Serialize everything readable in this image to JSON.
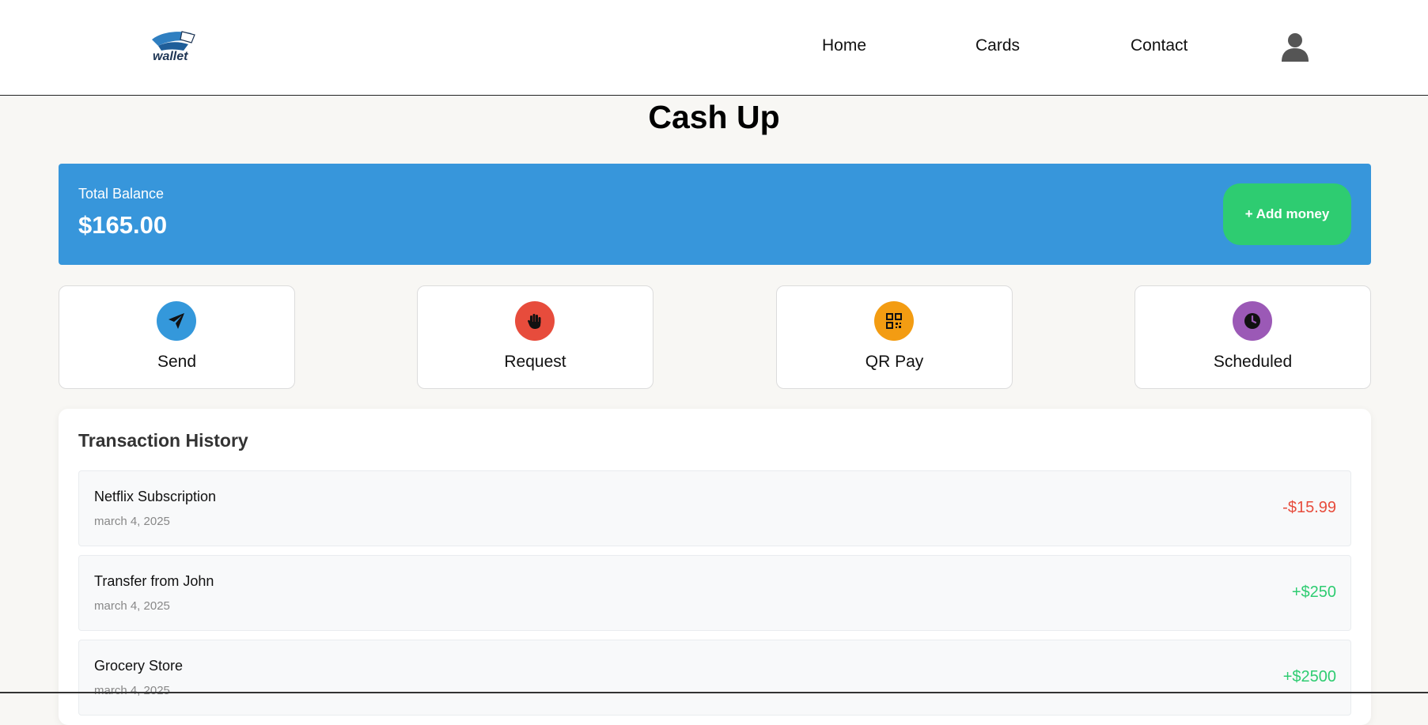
{
  "navbar": {
    "logo_text": "wallet",
    "links": [
      "Home",
      "Cards",
      "Contact"
    ]
  },
  "page": {
    "title": "Cash Up"
  },
  "balance": {
    "label": "Total Balance",
    "amount": "$165.00",
    "add_money_label": "+ Add money"
  },
  "actions": [
    {
      "label": "Send",
      "icon": "paper-plane-icon",
      "color": "#3498db"
    },
    {
      "label": "Request",
      "icon": "hand-icon",
      "color": "#e74c3c"
    },
    {
      "label": "QR Pay",
      "icon": "qr-code-icon",
      "color": "#f39c12"
    },
    {
      "label": "Scheduled",
      "icon": "clock-icon",
      "color": "#9b59b6"
    }
  ],
  "history": {
    "title": "Transaction History",
    "transactions": [
      {
        "name": "Netflix Subscription",
        "date": "march 4, 2025",
        "amount": "-$15.99"
      },
      {
        "name": "Transfer from John",
        "date": "march 4, 2025",
        "amount": "+$250"
      },
      {
        "name": "Grocery Store",
        "date": "march 4, 2025",
        "amount": "+$2500"
      }
    ]
  },
  "colors": {
    "accent": "#3796db",
    "positive": "#2ecc71",
    "negative": "#e74c3c",
    "background": "#f8f7f4"
  }
}
